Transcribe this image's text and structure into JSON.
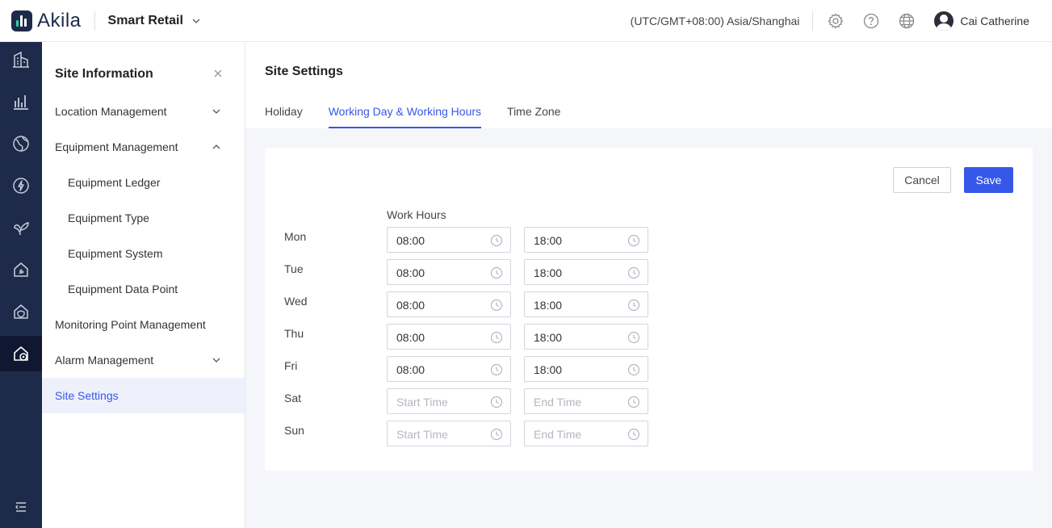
{
  "header": {
    "logo_text": "Akila",
    "project": "Smart Retail",
    "timezone": "(UTC/GMT+08:00) Asia/Shanghai",
    "user_name": "Cai Catherine"
  },
  "rail": {
    "items": [
      "buildings-icon",
      "chart-icon",
      "globe-leaf-icon",
      "energy-icon",
      "plant-icon",
      "home-wrench-icon",
      "home-shield-icon",
      "home-settings-icon"
    ],
    "active_index": 7
  },
  "sidenav": {
    "title": "Site Information",
    "items": [
      {
        "label": "Location Management",
        "chevron": "down",
        "sub": false
      },
      {
        "label": "Equipment Management",
        "chevron": "up",
        "sub": false
      },
      {
        "label": "Equipment Ledger",
        "sub": true
      },
      {
        "label": "Equipment Type",
        "sub": true
      },
      {
        "label": "Equipment System",
        "sub": true
      },
      {
        "label": "Equipment Data Point",
        "sub": true
      },
      {
        "label": "Monitoring Point Management",
        "sub": false
      },
      {
        "label": "Alarm Management",
        "chevron": "down",
        "sub": false
      },
      {
        "label": "Site Settings",
        "sub": false,
        "active": true
      }
    ]
  },
  "main": {
    "title": "Site Settings",
    "tabs": [
      {
        "label": "Holiday",
        "active": false
      },
      {
        "label": "Working Day & Working Hours",
        "active": true
      },
      {
        "label": "Time Zone",
        "active": false
      }
    ],
    "cancel_label": "Cancel",
    "save_label": "Save",
    "work_hours_label": "Work Hours",
    "days": [
      {
        "day": "Mon",
        "start": "08:00",
        "end": "18:00"
      },
      {
        "day": "Tue",
        "start": "08:00",
        "end": "18:00"
      },
      {
        "day": "Wed",
        "start": "08:00",
        "end": "18:00"
      },
      {
        "day": "Thu",
        "start": "08:00",
        "end": "18:00"
      },
      {
        "day": "Fri",
        "start": "08:00",
        "end": "18:00"
      },
      {
        "day": "Sat",
        "start": "",
        "end": "",
        "start_placeholder": "Start Time",
        "end_placeholder": "End Time"
      },
      {
        "day": "Sun",
        "start": "",
        "end": "",
        "start_placeholder": "Start Time",
        "end_placeholder": "End Time"
      }
    ]
  },
  "colors": {
    "accent": "#3657e8",
    "rail_bg": "#1e2a4a",
    "rail_active": "#0f1830",
    "page_bg": "#f5f6fa"
  }
}
